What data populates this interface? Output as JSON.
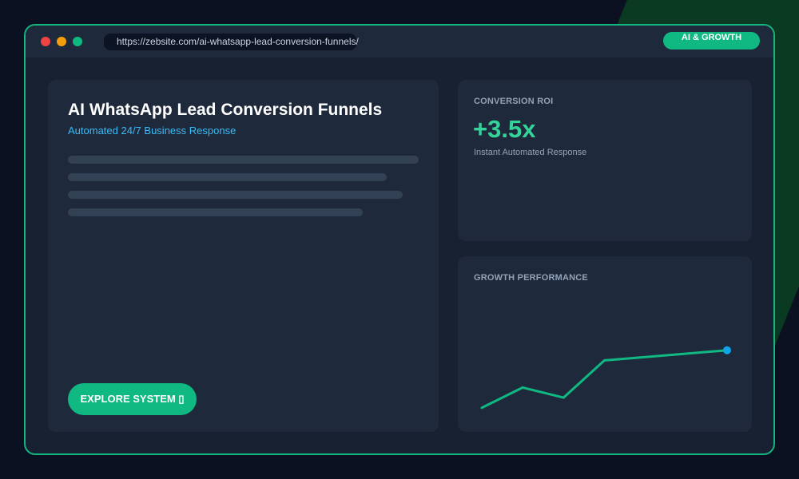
{
  "browser": {
    "url": "https://zebsite.com/ai-whatsapp-lead-conversion-funnels/",
    "badge": "AI & GROWTH"
  },
  "main_card": {
    "title": "AI WhatsApp Lead Conversion Funnels",
    "subtitle": "Automated 24/7 Business Response",
    "button_label": "EXPLORE SYSTEM ▯"
  },
  "roi_card": {
    "label": "CONVERSION ROI",
    "value": "+3.5x",
    "caption": "Instant Automated Response"
  },
  "growth_card": {
    "label": "GROWTH PERFORMANCE"
  },
  "chart_data": {
    "type": "line",
    "title": "",
    "xlabel": "",
    "ylabel": "",
    "x": [
      1,
      2,
      3,
      4,
      5,
      6,
      7
    ],
    "values": [
      1.0,
      2.2,
      1.6,
      3.8,
      4.0,
      4.2,
      4.4
    ],
    "ylim": [
      0,
      5
    ],
    "grid": false,
    "line_color": "#10b981",
    "endpoint_color": "#0ea5e9"
  },
  "colors": {
    "accent": "#10b981",
    "subtitle": "#38bdf8",
    "roi_value": "#34d399"
  }
}
